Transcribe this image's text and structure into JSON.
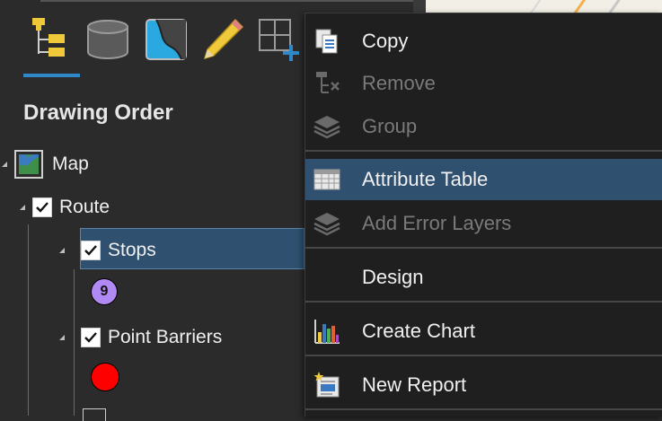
{
  "pane": {
    "title": "Drawing Order",
    "toolbar": [
      {
        "icon": "list-by-drawing-order-icon",
        "active": true
      },
      {
        "icon": "list-by-source-icon"
      },
      {
        "icon": "list-by-selection-icon"
      },
      {
        "icon": "list-by-editing-icon"
      },
      {
        "icon": "list-by-snapping-icon"
      }
    ],
    "tree": {
      "map": {
        "label": "Map"
      },
      "route": {
        "label": "Route",
        "checked": true
      },
      "stops": {
        "label": "Stops",
        "checked": true,
        "symbol_text": "9",
        "symbol_color": "#b189f5"
      },
      "point_barriers": {
        "label": "Point Barriers",
        "checked": true,
        "symbol_color": "#ff0000"
      }
    }
  },
  "context_menu": {
    "items": [
      {
        "label": "Copy",
        "icon": "copy-icon",
        "enabled": true
      },
      {
        "label": "Remove",
        "icon": "remove-layer-icon",
        "enabled": false
      },
      {
        "label": "Group",
        "icon": "group-layers-icon",
        "enabled": false
      },
      {
        "label": "Attribute Table",
        "icon": "attribute-table-icon",
        "enabled": true,
        "highlighted": true
      },
      {
        "label": "Add Error Layers",
        "icon": "add-error-layers-icon",
        "enabled": false
      },
      {
        "label": "Design",
        "icon": "",
        "enabled": true
      },
      {
        "label": "Create Chart",
        "icon": "create-chart-icon",
        "enabled": true
      },
      {
        "label": "New Report",
        "icon": "new-report-icon",
        "enabled": true
      }
    ]
  },
  "colors": {
    "accent": "#2f88c8",
    "selection": "#2f506f",
    "menu_background": "#1f1f1f",
    "pane_background": "#2b2b2b"
  }
}
